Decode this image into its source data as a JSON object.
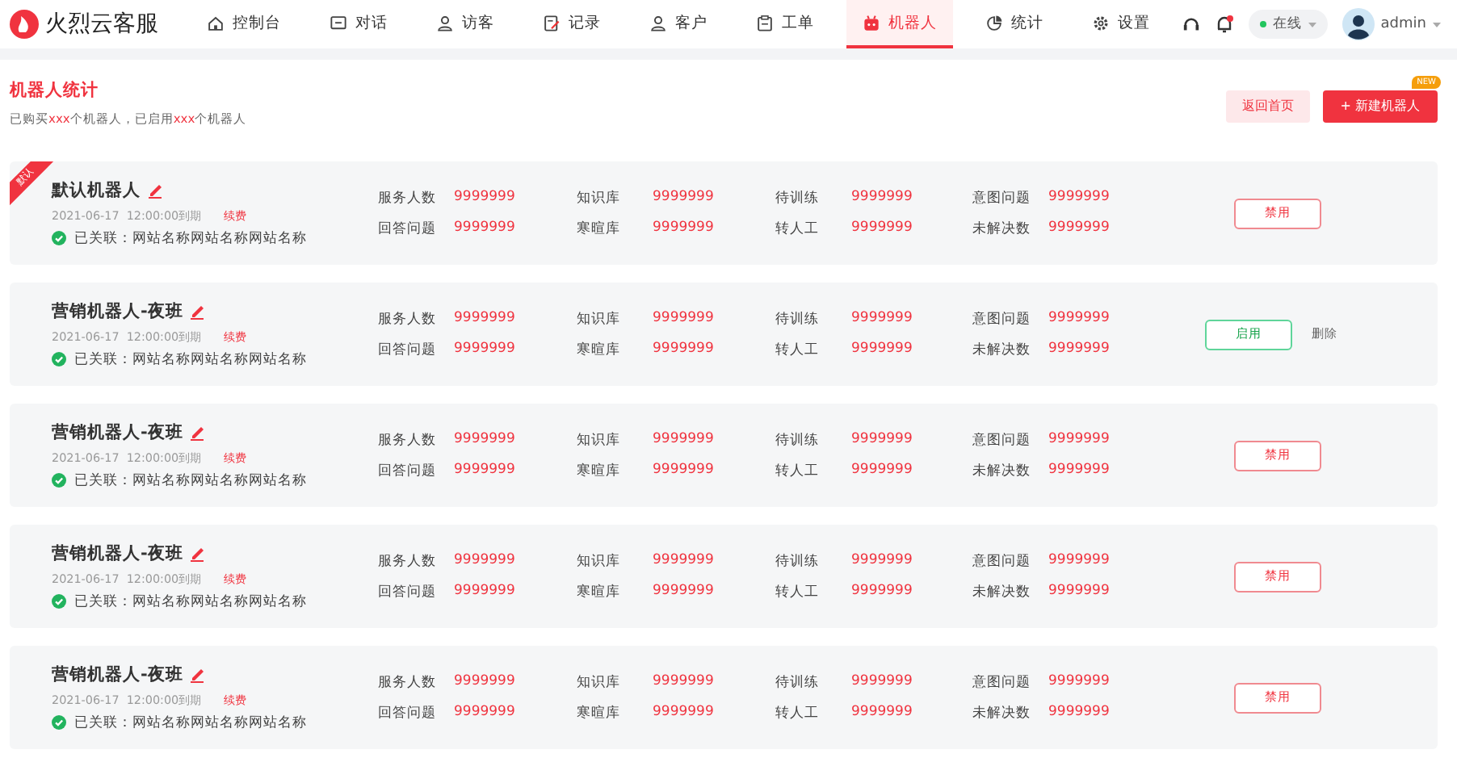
{
  "header": {
    "logo_text": "火烈云客服",
    "nav": [
      {
        "kind": "home",
        "label": "控制台",
        "selected": false
      },
      {
        "kind": "chat",
        "label": "对话",
        "selected": false
      },
      {
        "kind": "user",
        "label": "访客",
        "selected": false
      },
      {
        "kind": "edit",
        "label": "记录",
        "selected": false
      },
      {
        "kind": "user",
        "label": "客户",
        "selected": false
      },
      {
        "kind": "clipboard",
        "label": "工单",
        "selected": false
      },
      {
        "kind": "robot",
        "label": "机器人",
        "selected": true
      },
      {
        "kind": "pie",
        "label": "统计",
        "selected": false
      },
      {
        "kind": "gear",
        "label": "设置",
        "selected": false
      }
    ],
    "notification_unread": true,
    "status": {
      "label": "在线",
      "color": "#22c55e"
    },
    "user": {
      "name": "admin"
    }
  },
  "page": {
    "title": "机器人统计",
    "subtitle": [
      {
        "text": "已购买",
        "highlight": false
      },
      {
        "text": "xxx",
        "highlight": true
      },
      {
        "text": "个机器人，已启用",
        "highlight": false
      },
      {
        "text": "xxx",
        "highlight": true
      },
      {
        "text": "个机器人",
        "highlight": false
      }
    ],
    "buttons": [
      {
        "kind": "secondary",
        "label": "返回首页"
      },
      {
        "kind": "primary",
        "label": "+ 新建机器人",
        "badge": "NEW"
      }
    ]
  },
  "robots": [
    {
      "name": "默认机器人",
      "ribbon": "默认",
      "expiry": "2021-06-17  12:00:00到期",
      "renew": "续费",
      "linked": true,
      "linked_text": "已关联：网站名称网站名称网站名称",
      "stats": [
        {
          "label": "服务人数",
          "value": "9999999"
        },
        {
          "label": "知识库",
          "value": "9999999"
        },
        {
          "label": "待训练",
          "value": "9999999"
        },
        {
          "label": "意图问题",
          "value": "9999999"
        },
        {
          "label": "回答问题",
          "value": "9999999"
        },
        {
          "label": "寒暄库",
          "value": "9999999"
        },
        {
          "label": "转人工",
          "value": "9999999"
        },
        {
          "label": "未解决数",
          "value": "9999999"
        }
      ],
      "action": {
        "kind": "disable",
        "label": "禁用"
      }
    },
    {
      "name": "营销机器人-夜班",
      "expiry": "2021-06-17  12:00:00到期",
      "renew": "续费",
      "linked": true,
      "linked_text": "已关联：网站名称网站名称网站名称",
      "stats": [
        {
          "label": "服务人数",
          "value": "9999999"
        },
        {
          "label": "知识库",
          "value": "9999999"
        },
        {
          "label": "待训练",
          "value": "9999999"
        },
        {
          "label": "意图问题",
          "value": "9999999"
        },
        {
          "label": "回答问题",
          "value": "9999999"
        },
        {
          "label": "寒暄库",
          "value": "9999999"
        },
        {
          "label": "转人工",
          "value": "9999999"
        },
        {
          "label": "未解决数",
          "value": "9999999"
        }
      ],
      "action": {
        "kind": "enable",
        "label": "启用"
      },
      "delete_label": "删除"
    },
    {
      "name": "营销机器人-夜班",
      "expiry": "2021-06-17  12:00:00到期",
      "renew": "续费",
      "linked": true,
      "linked_text": "已关联：网站名称网站名称网站名称",
      "stats": [
        {
          "label": "服务人数",
          "value": "9999999"
        },
        {
          "label": "知识库",
          "value": "9999999"
        },
        {
          "label": "待训练",
          "value": "9999999"
        },
        {
          "label": "意图问题",
          "value": "9999999"
        },
        {
          "label": "回答问题",
          "value": "9999999"
        },
        {
          "label": "寒暄库",
          "value": "9999999"
        },
        {
          "label": "转人工",
          "value": "9999999"
        },
        {
          "label": "未解决数",
          "value": "9999999"
        }
      ],
      "action": {
        "kind": "disable",
        "label": "禁用"
      }
    },
    {
      "name": "营销机器人-夜班",
      "expiry": "2021-06-17  12:00:00到期",
      "renew": "续费",
      "linked": true,
      "linked_text": "已关联：网站名称网站名称网站名称",
      "stats": [
        {
          "label": "服务人数",
          "value": "9999999"
        },
        {
          "label": "知识库",
          "value": "9999999"
        },
        {
          "label": "待训练",
          "value": "9999999"
        },
        {
          "label": "意图问题",
          "value": "9999999"
        },
        {
          "label": "回答问题",
          "value": "9999999"
        },
        {
          "label": "寒暄库",
          "value": "9999999"
        },
        {
          "label": "转人工",
          "value": "9999999"
        },
        {
          "label": "未解决数",
          "value": "9999999"
        }
      ],
      "action": {
        "kind": "disable",
        "label": "禁用"
      }
    },
    {
      "name": "营销机器人-夜班",
      "expiry": "2021-06-17  12:00:00到期",
      "renew": "续费",
      "linked": true,
      "linked_text": "已关联：网站名称网站名称网站名称",
      "stats": [
        {
          "label": "服务人数",
          "value": "9999999"
        },
        {
          "label": "知识库",
          "value": "9999999"
        },
        {
          "label": "待训练",
          "value": "9999999"
        },
        {
          "label": "意图问题",
          "value": "9999999"
        },
        {
          "label": "回答问题",
          "value": "9999999"
        },
        {
          "label": "寒暄库",
          "value": "9999999"
        },
        {
          "label": "转人工",
          "value": "9999999"
        },
        {
          "label": "未解决数",
          "value": "9999999"
        }
      ],
      "action": {
        "kind": "disable",
        "label": "禁用"
      }
    }
  ]
}
